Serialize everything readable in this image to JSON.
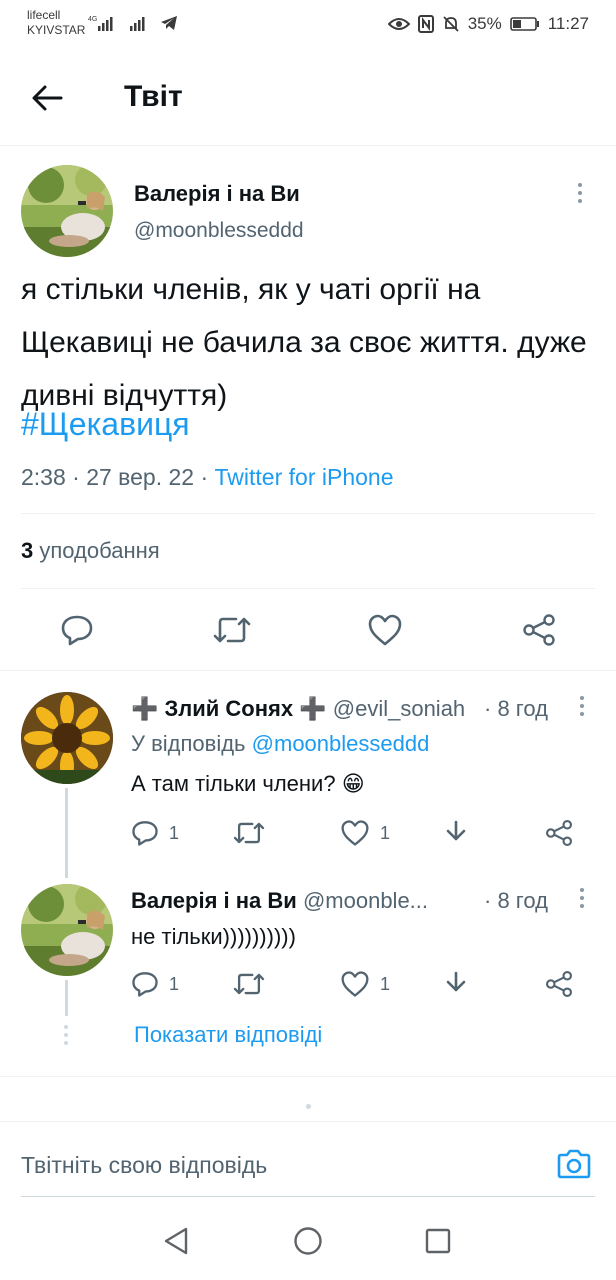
{
  "status_bar": {
    "carrier_1": "lifecell",
    "carrier_2": "KYIVSTAR",
    "battery": "35%",
    "time": "11:27"
  },
  "header": {
    "title": "Твіт"
  },
  "tweet": {
    "author_name": "Валерія і на Ви",
    "author_handle": "@moonblesseddd",
    "text": "я стільки членів, як у чаті оргії на Щекавиці не бачила за своє життя. дуже дивні відчуття)",
    "hashtag": "#Щекавиця",
    "time_date": "2:38 · 27 вер. 22 · ",
    "source": "Twitter for iPhone",
    "likes_count": "3",
    "likes_label": "уподобання"
  },
  "replies": [
    {
      "author_name": "➕ Злий Сонях ➕",
      "author_handle": "@evil_soniah",
      "time": "· 8 год",
      "reply_to_label": "У відповідь",
      "reply_to_handle": "@moonblesseddd",
      "text": "А там тільки члени? 😁",
      "reply_count": "1",
      "like_count": "1"
    },
    {
      "author_name": "Валерія і на Ви",
      "author_handle": "@moonble...",
      "time": "· 8 год",
      "text": "не тільки))))))))))",
      "reply_count": "1",
      "like_count": "1"
    }
  ],
  "show_replies_label": "Показати відповіді",
  "composer": {
    "placeholder": "Твітніть свою відповідь"
  },
  "colors": {
    "accent": "#1d9bf0",
    "text": "#0f1419",
    "secondary": "#536471"
  },
  "icons": [
    "back-arrow-icon",
    "more-icon",
    "reply-icon",
    "retweet-icon",
    "like-icon",
    "share-icon",
    "download-icon",
    "camera-icon",
    "nav-back-icon",
    "nav-home-icon",
    "nav-recents-icon"
  ]
}
